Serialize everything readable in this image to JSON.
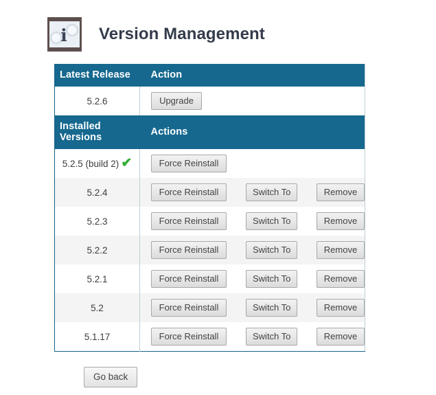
{
  "header": {
    "title": "Version Management",
    "icon": "info-image-icon"
  },
  "latest_release_section": {
    "columns": [
      "Latest Release",
      "Action"
    ],
    "row": {
      "version": "5.2.6",
      "action_label": "Upgrade"
    }
  },
  "installed_versions_section": {
    "columns": [
      "Installed Versions",
      "Actions"
    ],
    "rows": [
      {
        "version": "5.2.5 (build 2)",
        "active": true,
        "check_glyph": "✔",
        "buttons": [
          "Force Reinstall"
        ]
      },
      {
        "version": "5.2.4",
        "active": false,
        "buttons": [
          "Force Reinstall",
          "Switch To",
          "Remove"
        ]
      },
      {
        "version": "5.2.3",
        "active": false,
        "buttons": [
          "Force Reinstall",
          "Switch To",
          "Remove"
        ]
      },
      {
        "version": "5.2.2",
        "active": false,
        "buttons": [
          "Force Reinstall",
          "Switch To",
          "Remove"
        ]
      },
      {
        "version": "5.2.1",
        "active": false,
        "buttons": [
          "Force Reinstall",
          "Switch To",
          "Remove"
        ]
      },
      {
        "version": "5.2",
        "active": false,
        "buttons": [
          "Force Reinstall",
          "Switch To",
          "Remove"
        ]
      },
      {
        "version": "5.1.17",
        "active": false,
        "buttons": [
          "Force Reinstall",
          "Switch To",
          "Remove"
        ]
      }
    ]
  },
  "footer": {
    "go_back_label": "Go back"
  },
  "colors": {
    "header_bar": "#16688e",
    "page_background": "#ffffff",
    "title_text": "#343c4b",
    "stripe_row": "#f4f4f4",
    "check_green": "#34ab34",
    "table_border": "#bfcdd4",
    "button_face": "#e6e6e6"
  }
}
